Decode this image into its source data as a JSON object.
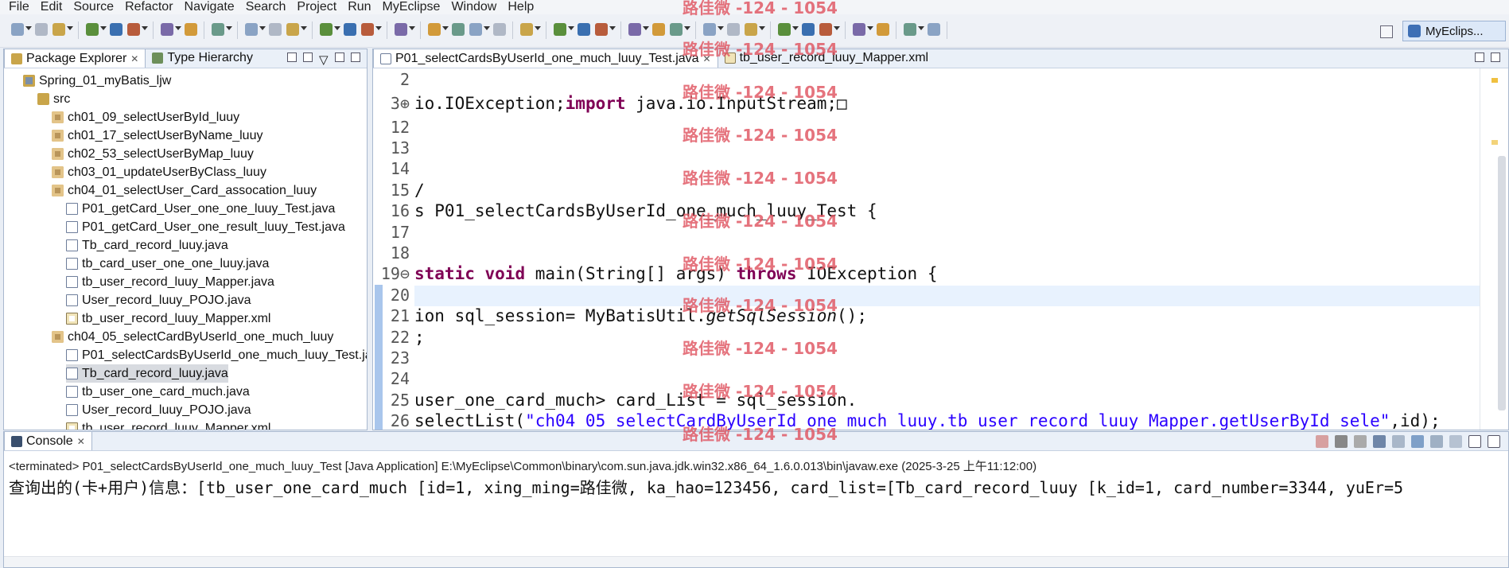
{
  "menu": [
    "File",
    "Edit",
    "Source",
    "Refactor",
    "Navigate",
    "Search",
    "Project",
    "Run",
    "MyEclipse",
    "Window",
    "Help"
  ],
  "perspective": {
    "label": "MyEclips...",
    "icon": "myeclipse-perspective-icon"
  },
  "explorer": {
    "tabs": [
      {
        "label": "Package Explorer",
        "close": "✕",
        "icon": "package-explorer-icon"
      },
      {
        "label": "Type Hierarchy",
        "icon": "type-hierarchy-icon"
      }
    ],
    "tree": [
      {
        "label": "Spring_01_myBatis_ljw",
        "indent": 0,
        "kind": "proj"
      },
      {
        "label": "src",
        "indent": 1,
        "kind": "src"
      },
      {
        "label": "ch01_09_selectUserById_luuy",
        "indent": 2,
        "kind": "pkg"
      },
      {
        "label": "ch01_17_selectUserByName_luuy",
        "indent": 2,
        "kind": "pkg"
      },
      {
        "label": "ch02_53_selectUserByMap_luuy",
        "indent": 2,
        "kind": "pkg"
      },
      {
        "label": "ch03_01_updateUserByClass_luuy",
        "indent": 2,
        "kind": "pkg"
      },
      {
        "label": "ch04_01_selectUser_Card_assocation_luuy",
        "indent": 2,
        "kind": "pkg"
      },
      {
        "label": "P01_getCard_User_one_one_luuy_Test.java",
        "indent": 3,
        "kind": "java"
      },
      {
        "label": "P01_getCard_User_one_result_luuy_Test.java",
        "indent": 3,
        "kind": "java"
      },
      {
        "label": "Tb_card_record_luuy.java",
        "indent": 3,
        "kind": "java"
      },
      {
        "label": "tb_card_user_one_one_luuy.java",
        "indent": 3,
        "kind": "java"
      },
      {
        "label": "tb_user_record_luuy_Mapper.java",
        "indent": 3,
        "kind": "java"
      },
      {
        "label": "User_record_luuy_POJO.java",
        "indent": 3,
        "kind": "java"
      },
      {
        "label": "tb_user_record_luuy_Mapper.xml",
        "indent": 3,
        "kind": "xml"
      },
      {
        "label": "ch04_05_selectCardByUserId_one_much_luuy",
        "indent": 2,
        "kind": "pkg"
      },
      {
        "label": "P01_selectCardsByUserId_one_much_luuy_Test.ja",
        "indent": 3,
        "kind": "java"
      },
      {
        "label": "Tb_card_record_luuy.java",
        "indent": 3,
        "kind": "java",
        "selected": true
      },
      {
        "label": "tb_user_one_card_much.java",
        "indent": 3,
        "kind": "java"
      },
      {
        "label": "User_record_luuy_POJO.java",
        "indent": 3,
        "kind": "java"
      },
      {
        "label": "tb_user_record_luuy_Mapper.xml",
        "indent": 3,
        "kind": "xml"
      }
    ]
  },
  "editor": {
    "tabs": [
      {
        "label": "P01_selectCardsByUserId_one_much_luuy_Test.java",
        "close": "✕",
        "active": true,
        "icon": "java-file-icon"
      },
      {
        "label": "tb_user_record_luuy_Mapper.xml",
        "active": false,
        "icon": "xml-file-icon"
      }
    ],
    "lines": [
      {
        "n": "2",
        "segs": []
      },
      {
        "n": "3⊕",
        "segs": [
          {
            "t": "io.IOException;",
            "c": ""
          },
          {
            "t": "import",
            "c": "kw"
          },
          {
            "t": " java.io.InputStream;□",
            "c": ""
          }
        ]
      },
      {
        "n": "12",
        "segs": []
      },
      {
        "n": "13",
        "segs": []
      },
      {
        "n": "14",
        "segs": []
      },
      {
        "n": "15",
        "segs": [
          {
            "t": "∕",
            "c": ""
          }
        ]
      },
      {
        "n": "16",
        "segs": [
          {
            "t": "s P01_selectCardsByUserId_one_much_luuy_Test {",
            "c": ""
          }
        ]
      },
      {
        "n": "17",
        "segs": []
      },
      {
        "n": "18",
        "segs": []
      },
      {
        "n": "19⊖",
        "segs": [
          {
            "t": "static",
            "c": "kw"
          },
          {
            "t": " ",
            "c": ""
          },
          {
            "t": "void",
            "c": "kw"
          },
          {
            "t": " main(String[] args) ",
            "c": ""
          },
          {
            "t": "throws",
            "c": "kw"
          },
          {
            "t": " IOException {",
            "c": ""
          }
        ]
      },
      {
        "n": "20",
        "segs": [],
        "current": true
      },
      {
        "n": "21",
        "segs": [
          {
            "t": "ion sql_session= MyBatisUtil.",
            "c": ""
          },
          {
            "t": "getSqlSession",
            "c": "it"
          },
          {
            "t": "();",
            "c": ""
          }
        ]
      },
      {
        "n": "22",
        "segs": [
          {
            "t": ";",
            "c": ""
          }
        ]
      },
      {
        "n": "23",
        "segs": []
      },
      {
        "n": "24",
        "segs": []
      },
      {
        "n": "25",
        "segs": [
          {
            "t": "user_one_card_much> card_List = sql_session.",
            "c": ""
          }
        ]
      },
      {
        "n": "26",
        "segs": [
          {
            "t": " selectList(",
            "c": ""
          },
          {
            "t": "\"ch04_05_selectCardByUserId_one_much_luuy.tb_user_record_luuy_Mapper.getUserById_sele\"",
            "c": "str"
          },
          {
            "t": ",id);",
            "c": ""
          }
        ]
      }
    ]
  },
  "console": {
    "tab": {
      "label": "Console",
      "close": "✕",
      "icon": "console-icon"
    },
    "status": "<terminated> P01_selectCardsByUserId_one_much_luuy_Test [Java Application] E:\\MyEclipse\\Common\\binary\\com.sun.java.jdk.win32.x86_64_1.6.0.013\\bin\\javaw.exe (2025-3-25 上午11:12:00)",
    "output": "查询出的(卡+用户)信息：[tb_user_one_card_much [id=1, xing_ming=路佳微, ka_hao=123456, card_list=[Tb_card_record_luuy [k_id=1, card_number=3344, yuEr=5"
  },
  "watermark": "路佳微 -124 - 1054"
}
